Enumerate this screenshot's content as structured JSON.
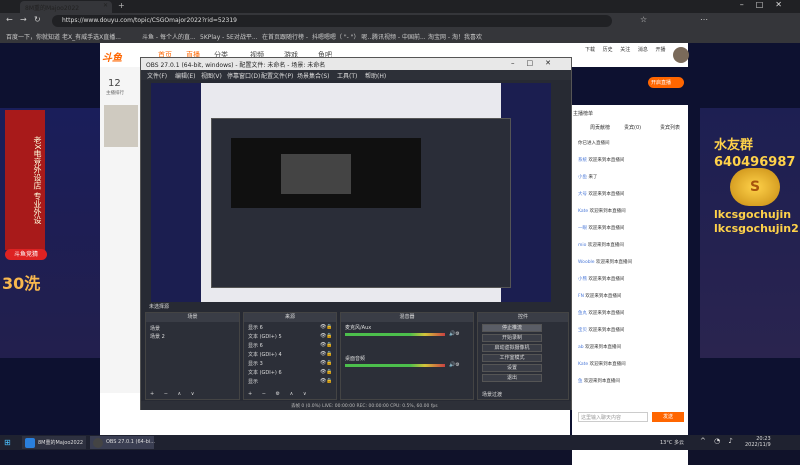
{
  "browser": {
    "tab_title": "8M重的Majoo2022",
    "url": "https://www.douyu.com/topic/CSGOmajor2022?rid=52319",
    "bookmarks": [
      "百度一下，你就知道",
      "老X_有威手选X直播...",
      "斗鱼 - 每个人的直...",
      "5KPlay - 5E对战平...",
      "在首页跟随行榜 -",
      "抖嗯嗯嗯（ \"- \"） 呢...",
      "腾讯视频 - 中国前...",
      "淘宝网 - 淘！我喜欢"
    ],
    "new_tab": "+",
    "window_controls": [
      "–",
      "□",
      "✕"
    ]
  },
  "site": {
    "logo": "斗鱼",
    "nav": [
      "首页",
      "直播",
      "分类",
      "视频",
      "游戏",
      "鱼吧"
    ],
    "header_icons": [
      "下载",
      "历史",
      "关注",
      "消息",
      "开播"
    ],
    "open_live": "开启直播",
    "count": "12",
    "count_label": "主播排行",
    "left_banner_text": "老X电竞外设店 专业外设",
    "left_red_label": "斗鱼竞猜",
    "left_big": "30洗",
    "right_big_1": "水友群",
    "right_big_2": "640496987",
    "right_id_1": "lkcsgochujin",
    "right_id_2": "lkcsgochujin2",
    "medal_text": "S",
    "chat": {
      "header": "主播榜单",
      "tabs": [
        "周贡献榜",
        "贵宾(0)",
        "贵宾列表"
      ],
      "lines": [
        {
          "user": "",
          "text": "你已进入直播间"
        },
        {
          "user": "系统",
          "text": "欢迎来到本直播间"
        },
        {
          "user": "小鱼",
          "text": "来了"
        },
        {
          "user": "大号",
          "text": "欢迎来到本直播间"
        },
        {
          "user": "Kate",
          "text": "欢迎来到本直播间"
        },
        {
          "user": "一眼",
          "text": "欢迎来到本直播间"
        },
        {
          "user": "mio",
          "text": "欢迎来到本直播间"
        },
        {
          "user": "Wooble",
          "text": "欢迎来到本直播间"
        },
        {
          "user": "小熊",
          "text": "欢迎来到本直播间"
        },
        {
          "user": "FN",
          "text": "欢迎来到本直播间"
        },
        {
          "user": "鱼丸",
          "text": "欢迎来到本直播间"
        },
        {
          "user": "宝贝",
          "text": "欢迎来到本直播间"
        },
        {
          "user": "ab",
          "text": "欢迎来到本直播间"
        },
        {
          "user": "Kate",
          "text": "欢迎来到本直播间"
        },
        {
          "user": "鱼",
          "text": "欢迎来到本直播间"
        }
      ],
      "input_placeholder": "这里输入聊天内容",
      "send": "发送"
    }
  },
  "obs": {
    "title": "OBS 27.0.1 (64-bit, windows) - 配置文件: 未命名 - 场景: 未命名",
    "window_controls": [
      "–",
      "□",
      "✕"
    ],
    "menu": [
      "文件(F)",
      "编辑(E)",
      "视图(V)",
      "停靠窗口(D)",
      "配置文件(P)",
      "场景集合(S)",
      "工具(T)",
      "帮助(H)"
    ],
    "scene_label": "未选择源",
    "docks": {
      "scenes": {
        "title": "场景",
        "items": [
          "场景",
          "场景 2"
        ]
      },
      "sources": {
        "title": "来源",
        "items": [
          "显示 6",
          "文本 (GDI+) 5",
          "显示 6",
          "文本 (GDI+) 4",
          "显示 3",
          "文本 (GDI+) 6",
          "显示"
        ]
      },
      "mixer": {
        "title": "混音器",
        "tracks": [
          "麦克风/Aux",
          "桌面音频"
        ]
      },
      "transitions": {
        "title": "场景过渡"
      },
      "controls": {
        "title": "控件",
        "buttons": [
          "停止推流",
          "开始录制",
          "启动虚拟摄像机",
          "工作室模式",
          "设置",
          "退出"
        ]
      }
    },
    "status": "丢帧 0 (0.0%)   LIVE: 00:00:00   REC: 00:00:00   CPU: 0.5%, 60.00 fps"
  },
  "taskbar": {
    "items": [
      "8M重的Majoo2022",
      "OBS 27.0.1 (64-bi..."
    ],
    "weather": "13°C 多云",
    "time": "20:23",
    "date": "2022/11/9"
  }
}
